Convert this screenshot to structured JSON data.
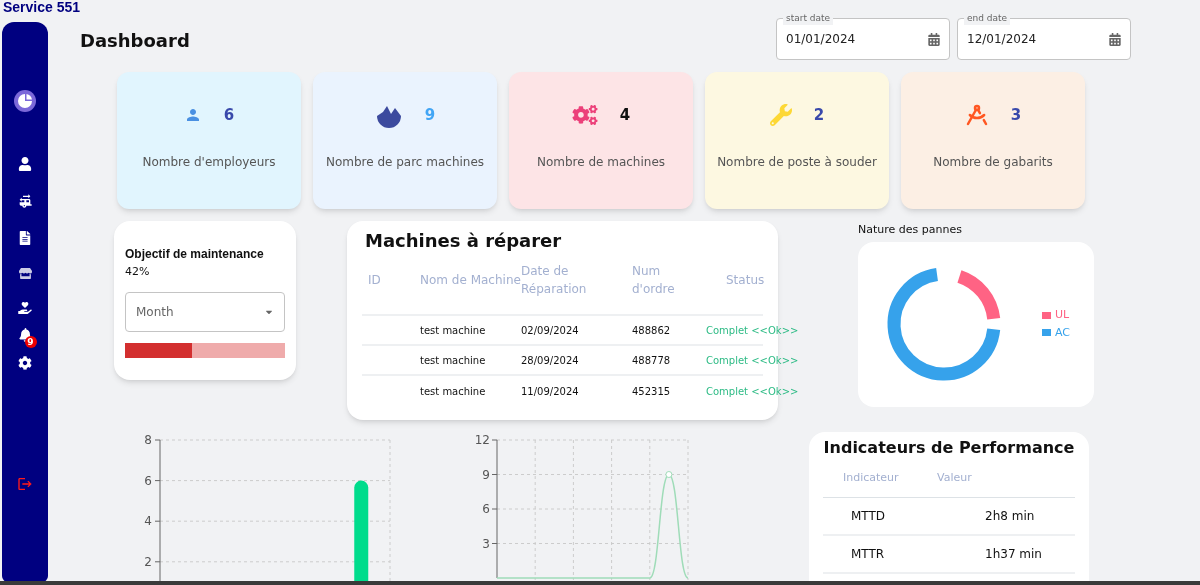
{
  "app_title": "Service 551",
  "sidebar": {
    "notification_badge": "9"
  },
  "page_title": "Dashboard",
  "date_filters": [
    {
      "label": "start date",
      "value": "01/01/2024"
    },
    {
      "label": "end date",
      "value": "12/01/2024"
    }
  ],
  "stat_cards": [
    {
      "kind": "employees",
      "value": "6",
      "label": "Nombre d'employeurs"
    },
    {
      "kind": "parks",
      "value": "9",
      "label": "Nombre de parc machines"
    },
    {
      "kind": "machines",
      "value": "4",
      "label": "Nombre de machines"
    },
    {
      "kind": "welding",
      "value": "2",
      "label": "Nombre de poste à souder"
    },
    {
      "kind": "jigs",
      "value": "3",
      "label": "Nombre de gabarits"
    }
  ],
  "maintenance_objective": {
    "title": "Objectif de maintenance",
    "percent": "42%",
    "period_select": {
      "value": "Month"
    },
    "level": 0.42
  },
  "machines_to_repair": {
    "title": "Machines à réparer",
    "columns": [
      "ID",
      "Nom de Machine",
      "Date de Réparation",
      "Num d'ordre",
      "Status"
    ],
    "rows": [
      {
        "name": "test machine",
        "date": "02/09/2024",
        "order": "488862",
        "status": "Complet <<Ok>>"
      },
      {
        "name": "test machine",
        "date": "28/09/2024",
        "order": "488778",
        "status": "Complet <<Ok>>"
      },
      {
        "name": "test machine",
        "date": "11/09/2024",
        "order": "452315",
        "status": "Complet <<Ok>>"
      }
    ]
  },
  "failure_types": {
    "title": "Nature des pannes",
    "legend": [
      {
        "label": "UL",
        "color": "#ff6384"
      },
      {
        "label": "AC",
        "color": "#36a2eb"
      }
    ]
  },
  "bar_chart": {
    "chart_data": {
      "type": "bar",
      "ylim": [
        1,
        8
      ],
      "yticks": [
        2,
        4,
        6,
        8
      ],
      "grid": true,
      "values": [
        null,
        null,
        null,
        6
      ]
    }
  },
  "line_chart": {
    "chart_data": {
      "type": "line",
      "ylim": [
        0,
        12
      ],
      "yticks": [
        3,
        6,
        9,
        12
      ],
      "grid": true,
      "values": [
        0,
        0,
        0,
        0,
        0,
        0,
        0,
        0,
        0,
        9,
        0
      ]
    }
  },
  "performance_indicators": {
    "title": "Indicateurs de Performance",
    "columns": [
      "Indicateur",
      "Valeur"
    ],
    "rows": [
      {
        "indicator": "MTTD",
        "value": "2h8 min"
      },
      {
        "indicator": "MTTR",
        "value": "1h37 min"
      }
    ]
  }
}
